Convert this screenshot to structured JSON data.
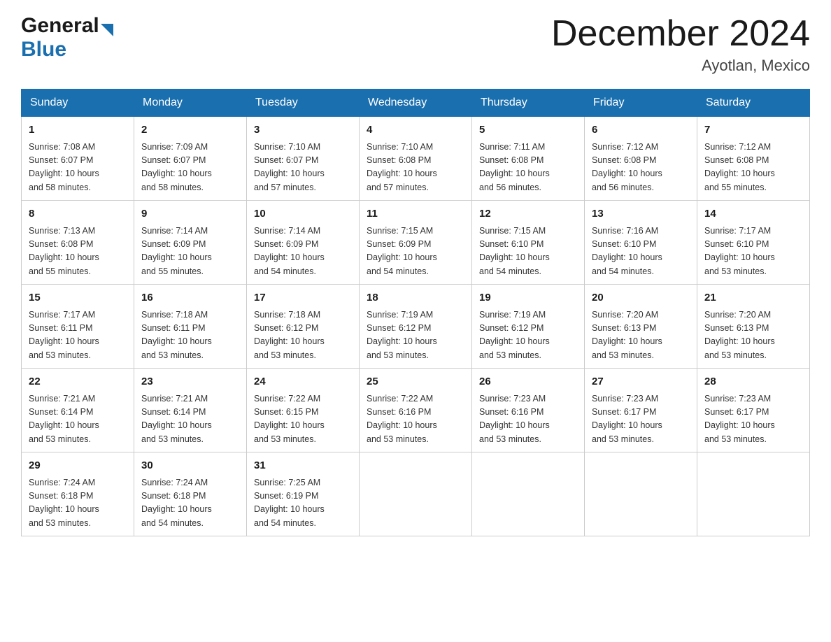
{
  "header": {
    "logo_general": "General",
    "logo_blue": "Blue",
    "month_title": "December 2024",
    "location": "Ayotlan, Mexico"
  },
  "days_of_week": [
    "Sunday",
    "Monday",
    "Tuesday",
    "Wednesday",
    "Thursday",
    "Friday",
    "Saturday"
  ],
  "weeks": [
    [
      {
        "day": "1",
        "sunrise": "7:08 AM",
        "sunset": "6:07 PM",
        "daylight": "10 hours and 58 minutes."
      },
      {
        "day": "2",
        "sunrise": "7:09 AM",
        "sunset": "6:07 PM",
        "daylight": "10 hours and 58 minutes."
      },
      {
        "day": "3",
        "sunrise": "7:10 AM",
        "sunset": "6:07 PM",
        "daylight": "10 hours and 57 minutes."
      },
      {
        "day": "4",
        "sunrise": "7:10 AM",
        "sunset": "6:08 PM",
        "daylight": "10 hours and 57 minutes."
      },
      {
        "day": "5",
        "sunrise": "7:11 AM",
        "sunset": "6:08 PM",
        "daylight": "10 hours and 56 minutes."
      },
      {
        "day": "6",
        "sunrise": "7:12 AM",
        "sunset": "6:08 PM",
        "daylight": "10 hours and 56 minutes."
      },
      {
        "day": "7",
        "sunrise": "7:12 AM",
        "sunset": "6:08 PM",
        "daylight": "10 hours and 55 minutes."
      }
    ],
    [
      {
        "day": "8",
        "sunrise": "7:13 AM",
        "sunset": "6:08 PM",
        "daylight": "10 hours and 55 minutes."
      },
      {
        "day": "9",
        "sunrise": "7:14 AM",
        "sunset": "6:09 PM",
        "daylight": "10 hours and 55 minutes."
      },
      {
        "day": "10",
        "sunrise": "7:14 AM",
        "sunset": "6:09 PM",
        "daylight": "10 hours and 54 minutes."
      },
      {
        "day": "11",
        "sunrise": "7:15 AM",
        "sunset": "6:09 PM",
        "daylight": "10 hours and 54 minutes."
      },
      {
        "day": "12",
        "sunrise": "7:15 AM",
        "sunset": "6:10 PM",
        "daylight": "10 hours and 54 minutes."
      },
      {
        "day": "13",
        "sunrise": "7:16 AM",
        "sunset": "6:10 PM",
        "daylight": "10 hours and 54 minutes."
      },
      {
        "day": "14",
        "sunrise": "7:17 AM",
        "sunset": "6:10 PM",
        "daylight": "10 hours and 53 minutes."
      }
    ],
    [
      {
        "day": "15",
        "sunrise": "7:17 AM",
        "sunset": "6:11 PM",
        "daylight": "10 hours and 53 minutes."
      },
      {
        "day": "16",
        "sunrise": "7:18 AM",
        "sunset": "6:11 PM",
        "daylight": "10 hours and 53 minutes."
      },
      {
        "day": "17",
        "sunrise": "7:18 AM",
        "sunset": "6:12 PM",
        "daylight": "10 hours and 53 minutes."
      },
      {
        "day": "18",
        "sunrise": "7:19 AM",
        "sunset": "6:12 PM",
        "daylight": "10 hours and 53 minutes."
      },
      {
        "day": "19",
        "sunrise": "7:19 AM",
        "sunset": "6:12 PM",
        "daylight": "10 hours and 53 minutes."
      },
      {
        "day": "20",
        "sunrise": "7:20 AM",
        "sunset": "6:13 PM",
        "daylight": "10 hours and 53 minutes."
      },
      {
        "day": "21",
        "sunrise": "7:20 AM",
        "sunset": "6:13 PM",
        "daylight": "10 hours and 53 minutes."
      }
    ],
    [
      {
        "day": "22",
        "sunrise": "7:21 AM",
        "sunset": "6:14 PM",
        "daylight": "10 hours and 53 minutes."
      },
      {
        "day": "23",
        "sunrise": "7:21 AM",
        "sunset": "6:14 PM",
        "daylight": "10 hours and 53 minutes."
      },
      {
        "day": "24",
        "sunrise": "7:22 AM",
        "sunset": "6:15 PM",
        "daylight": "10 hours and 53 minutes."
      },
      {
        "day": "25",
        "sunrise": "7:22 AM",
        "sunset": "6:16 PM",
        "daylight": "10 hours and 53 minutes."
      },
      {
        "day": "26",
        "sunrise": "7:23 AM",
        "sunset": "6:16 PM",
        "daylight": "10 hours and 53 minutes."
      },
      {
        "day": "27",
        "sunrise": "7:23 AM",
        "sunset": "6:17 PM",
        "daylight": "10 hours and 53 minutes."
      },
      {
        "day": "28",
        "sunrise": "7:23 AM",
        "sunset": "6:17 PM",
        "daylight": "10 hours and 53 minutes."
      }
    ],
    [
      {
        "day": "29",
        "sunrise": "7:24 AM",
        "sunset": "6:18 PM",
        "daylight": "10 hours and 53 minutes."
      },
      {
        "day": "30",
        "sunrise": "7:24 AM",
        "sunset": "6:18 PM",
        "daylight": "10 hours and 54 minutes."
      },
      {
        "day": "31",
        "sunrise": "7:25 AM",
        "sunset": "6:19 PM",
        "daylight": "10 hours and 54 minutes."
      },
      null,
      null,
      null,
      null
    ]
  ],
  "labels": {
    "sunrise": "Sunrise:",
    "sunset": "Sunset:",
    "daylight": "Daylight:"
  }
}
